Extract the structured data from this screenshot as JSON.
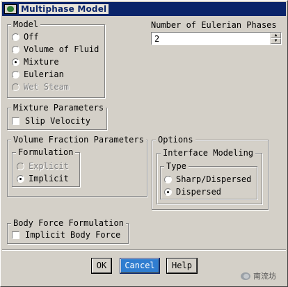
{
  "window": {
    "title": "Multiphase Model"
  },
  "model": {
    "legend": "Model",
    "options": [
      {
        "label": "Off",
        "selected": false,
        "enabled": true
      },
      {
        "label": "Volume of Fluid",
        "selected": false,
        "enabled": true
      },
      {
        "label": "Mixture",
        "selected": true,
        "enabled": true
      },
      {
        "label": "Eulerian",
        "selected": false,
        "enabled": true
      },
      {
        "label": "Wet Steam",
        "selected": false,
        "enabled": false
      }
    ]
  },
  "phases": {
    "label": "Number of Eulerian Phases",
    "value": "2"
  },
  "mixture_params": {
    "legend": "Mixture Parameters",
    "slip_velocity_label": "Slip Velocity",
    "slip_velocity_checked": false
  },
  "vf_params": {
    "legend": "Volume Fraction Parameters",
    "formulation_legend": "Formulation",
    "options": [
      {
        "label": "Explicit",
        "selected": false,
        "enabled": false
      },
      {
        "label": "Implicit",
        "selected": true,
        "enabled": true
      }
    ]
  },
  "options_group": {
    "legend": "Options",
    "interface_legend": "Interface Modeling",
    "type_legend": "Type",
    "types": [
      {
        "label": "Sharp/Dispersed",
        "selected": false
      },
      {
        "label": "Dispersed",
        "selected": true
      }
    ]
  },
  "body_force": {
    "legend": "Body Force Formulation",
    "implicit_label": "Implicit Body Force",
    "implicit_checked": false
  },
  "buttons": {
    "ok": "OK",
    "cancel": "Cancel",
    "help": "Help"
  },
  "watermark": {
    "text": "南流坊"
  },
  "colors": {
    "title_bar": "#0a246a",
    "dialog_bg": "#d4d0c8",
    "focus_button": "#2f7dd0"
  }
}
